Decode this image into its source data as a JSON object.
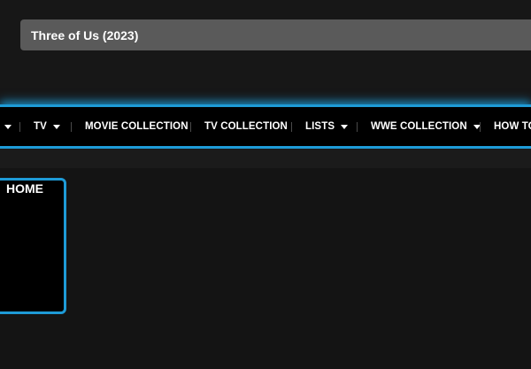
{
  "search": {
    "value": "Three of Us (2023)"
  },
  "nav": {
    "items": [
      {
        "label": "TV",
        "has_dropdown": true
      },
      {
        "label": "MOVIE COLLECTION",
        "has_dropdown": false
      },
      {
        "label": "TV COLLECTION",
        "has_dropdown": false
      },
      {
        "label": "LISTS",
        "has_dropdown": true
      },
      {
        "label": "WWE COLLECTION",
        "has_dropdown": true
      },
      {
        "label": "HOW TO",
        "has_dropdown": false
      }
    ]
  },
  "home_panel": {
    "label": "HOME"
  },
  "colors": {
    "accent": "#1e9bd7",
    "background": "#141414",
    "search_bg": "#5a5a5a"
  }
}
